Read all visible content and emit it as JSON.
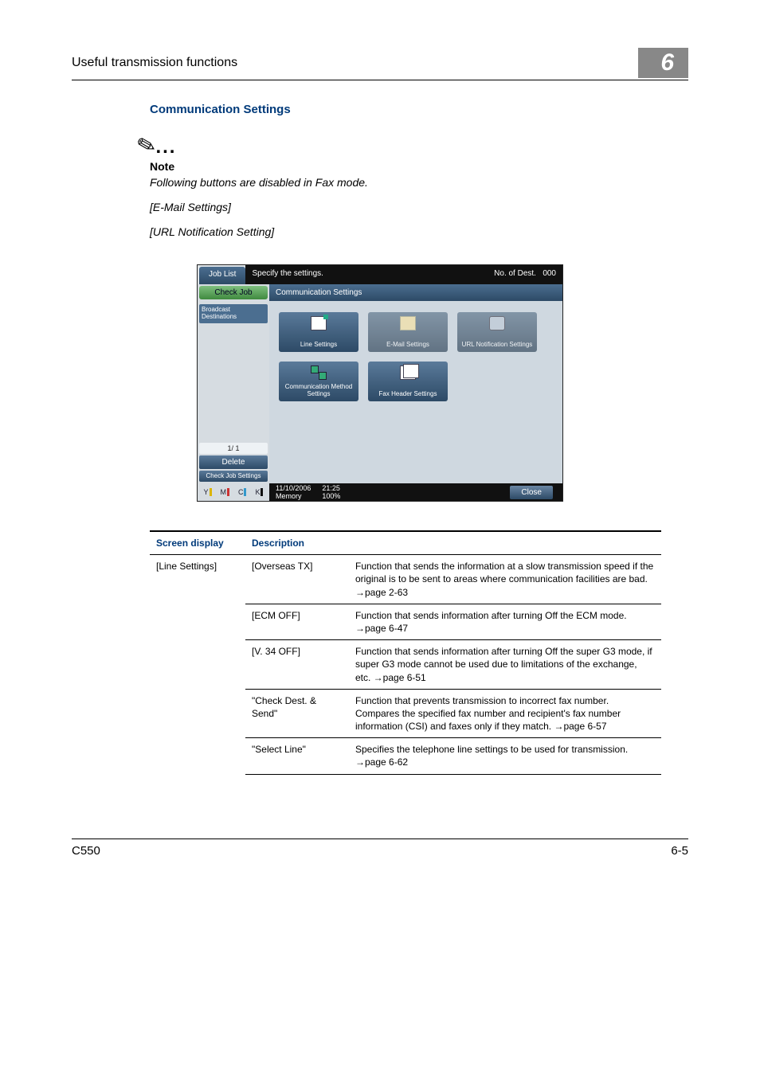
{
  "header": {
    "section_title": "Useful transmission functions",
    "chapter": "6"
  },
  "section": {
    "heading": "Communication Settings"
  },
  "note": {
    "label": "Note",
    "line1_italic": "Following buttons are disabled in Fax mode.",
    "line2_italic": "[E-Mail Settings]",
    "line3_italic": "[URL Notification Setting]"
  },
  "screenshot": {
    "job_list": "Job List",
    "top_msg": "Specify the settings.",
    "top_right_small": "No. of Dest.",
    "top_right_count": "000",
    "check_job": "Check Job",
    "side_item": "Broadcast Destinations",
    "pager": "1/ 1",
    "delete": "Delete",
    "check_set": "Check Job Settings",
    "panel_title": "Communication Settings",
    "tiles": {
      "line": "Line Settings",
      "email": "E-Mail Settings",
      "url": "URL Notification Settings",
      "method": "Communication Method Settings",
      "header": "Fax Header Settings"
    },
    "toner": {
      "y": "Y",
      "m": "M",
      "c": "C",
      "k": "K"
    },
    "status_date": "11/10/2006",
    "status_time": "21:25",
    "status_mem_label": "Memory",
    "status_mem_val": "100%",
    "close": "Close"
  },
  "table": {
    "h1": "Screen display",
    "h2": "Description",
    "col1_line": "[Line Settings]",
    "rows": [
      {
        "c2": "[Overseas TX]",
        "c3": "Function that sends the information at a slow transmission speed if the original is to be sent to areas where communication facilities are bad. →page 2-63"
      },
      {
        "c2": "[ECM OFF]",
        "c3": "Function that sends information after turning Off the ECM mode. →page 6-47"
      },
      {
        "c2": "[V. 34 OFF]",
        "c3": "Function that sends information after turning Off the super G3 mode, if super G3 mode cannot be used due to limitations of the exchange, etc. →page 6-51"
      },
      {
        "c2": "\"Check Dest. & Send\"",
        "c3": "Function that prevents transmission to incorrect fax number. Compares the specified fax number and recipient's fax number information (CSI) and faxes only if they match. →page 6-57"
      },
      {
        "c2": "\"Select Line\"",
        "c3": "Specifies the telephone line settings to be used for transmission. →page 6-62"
      }
    ]
  },
  "footer": {
    "model": "C550",
    "page": "6-5"
  }
}
